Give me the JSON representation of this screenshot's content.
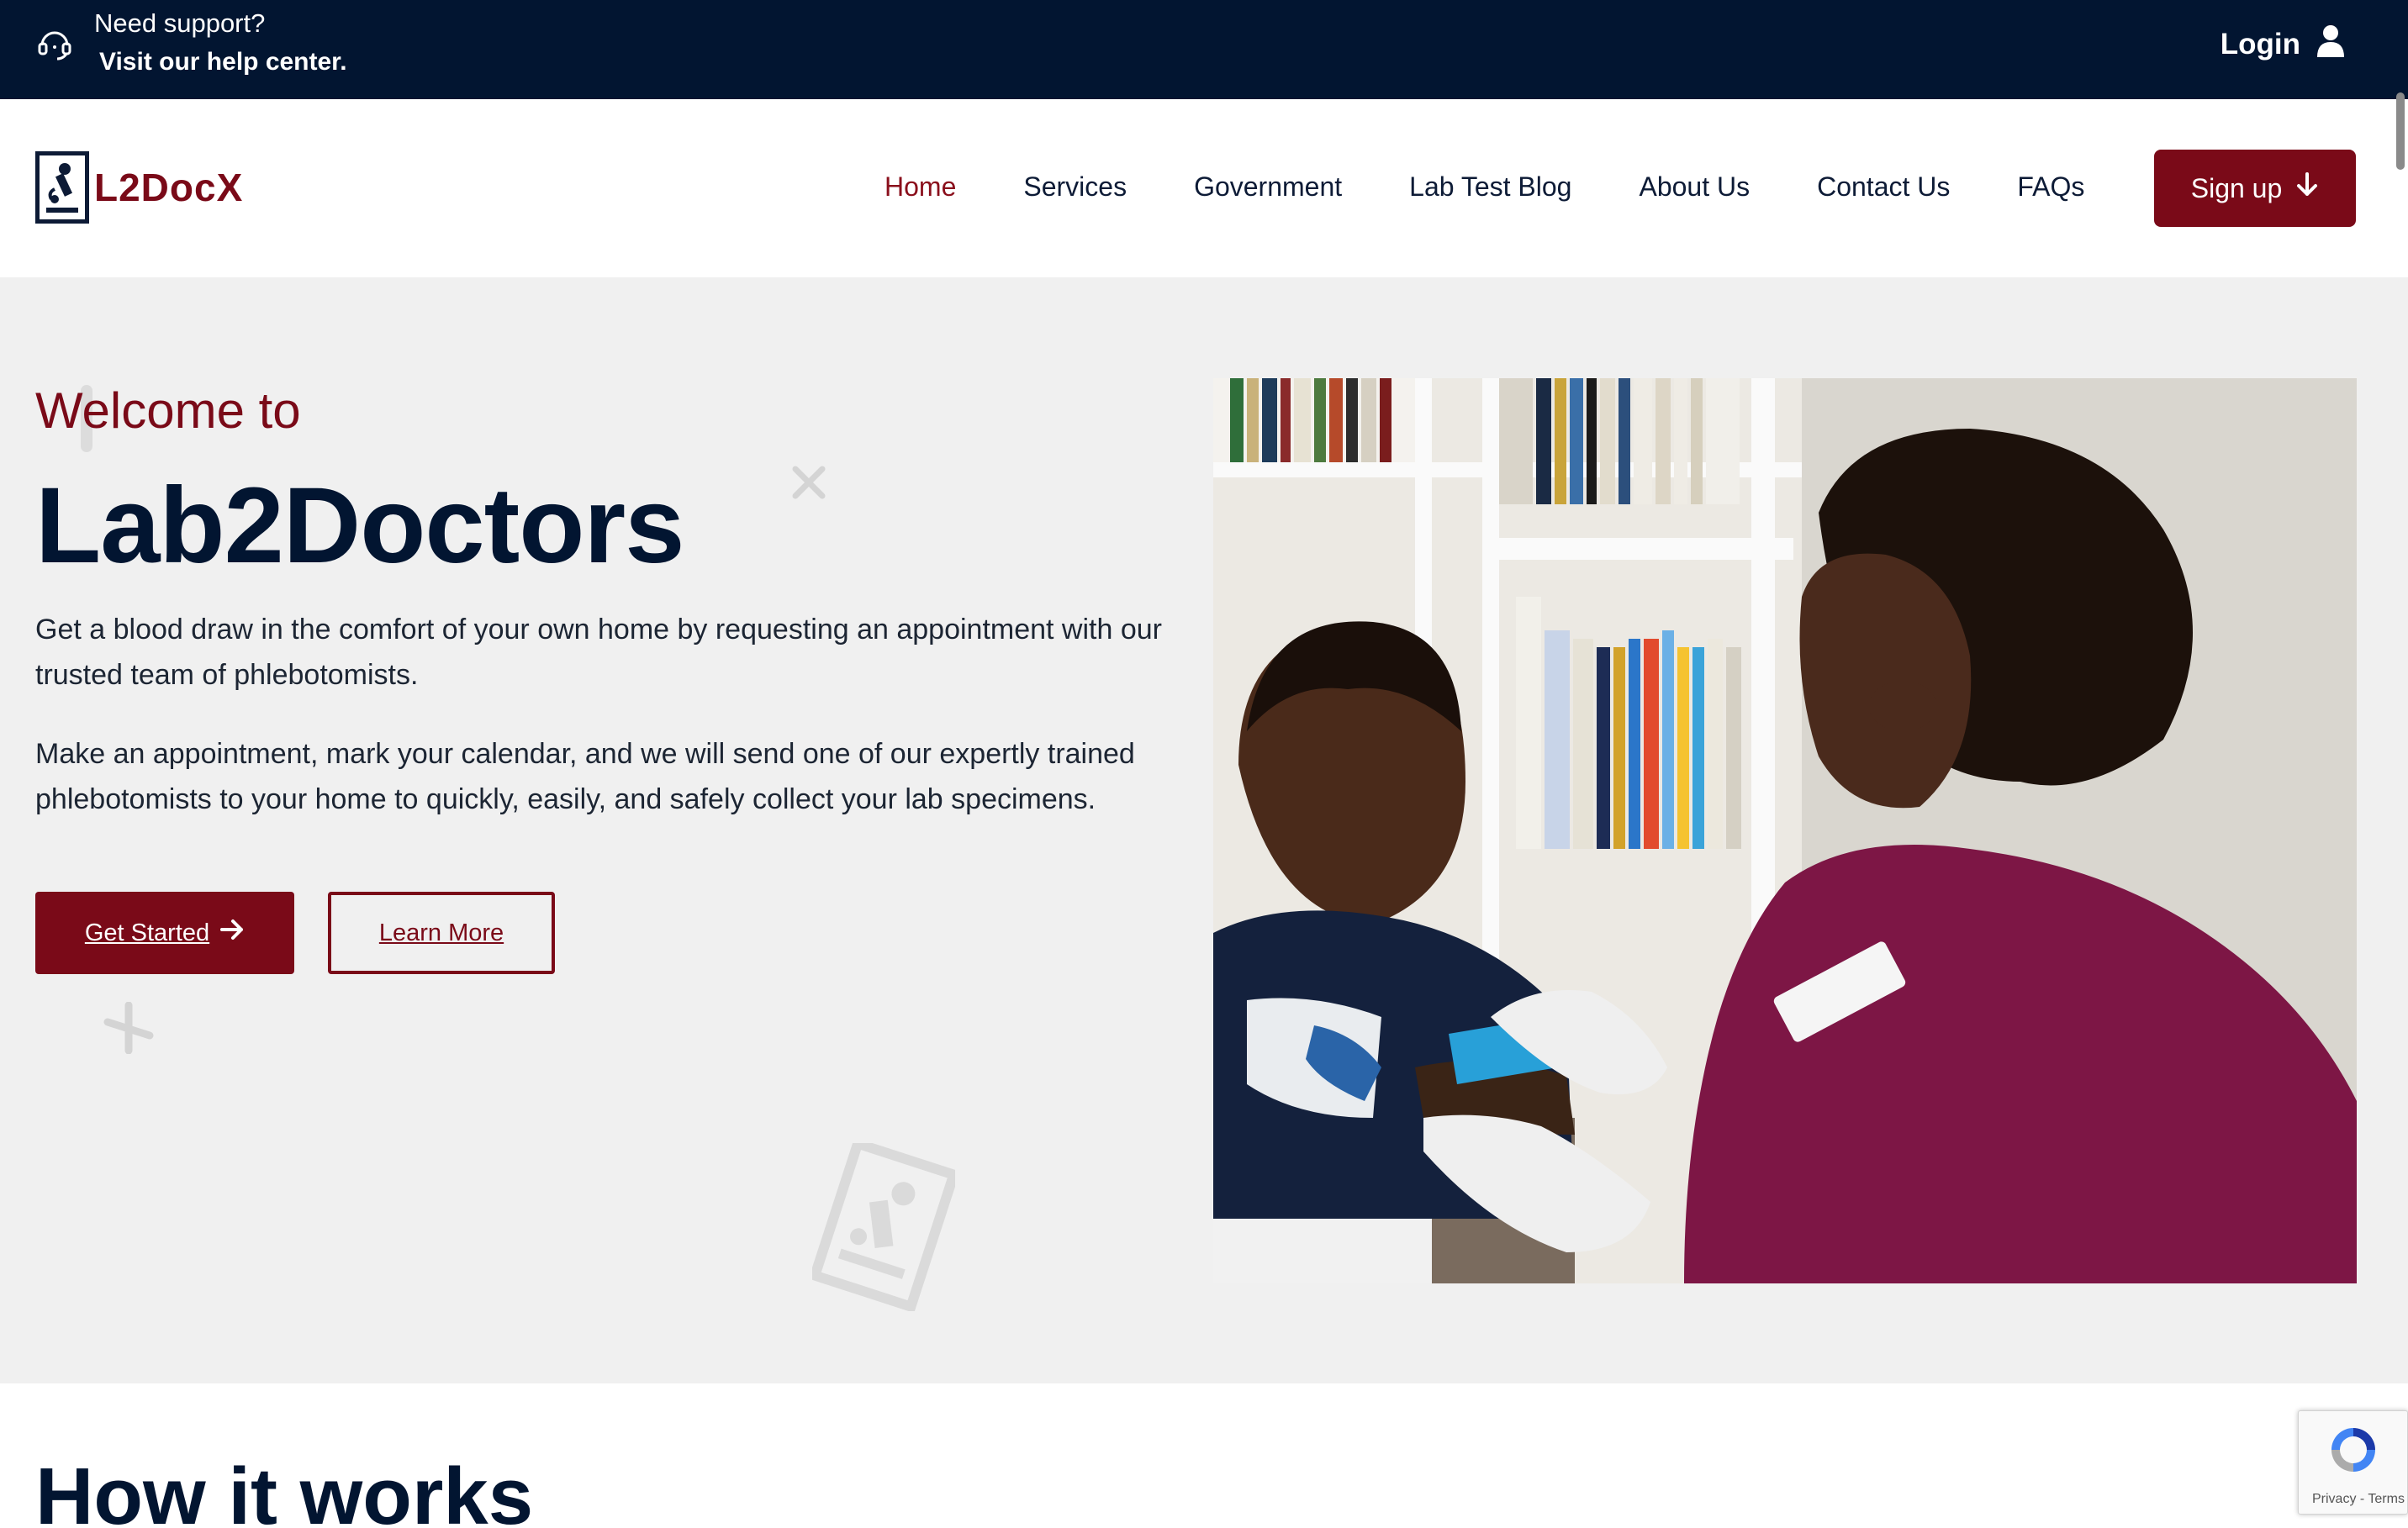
{
  "topbar": {
    "support_line1": "Need support?",
    "support_line2": "Visit our help center.",
    "login_label": "Login",
    "support_icon": "headset-icon",
    "login_icon": "user-icon"
  },
  "nav": {
    "logo_text": "L2DocX",
    "links": [
      "Home",
      "Services",
      "Government",
      "Lab Test Blog",
      "About Us",
      "Contact Us",
      "FAQs"
    ],
    "active": "Home",
    "signup_label": "Sign up",
    "signup_icon": "arrow-down-icon"
  },
  "hero": {
    "welcome": "Welcome to",
    "brand": "Lab2Doctors",
    "paragraph1": "Get a blood draw in the comfort of your own home by requesting an appointment with our trusted team of phlebotomists.",
    "paragraph2": "Make an appointment, mark your calendar, and we will send one of our expertly trained phlebotomists to your home to quickly, easily, and safely collect your lab specimens.",
    "primary_button": "Get Started",
    "secondary_button": "Learn More",
    "photo_alt": "photo"
  },
  "how": {
    "title": "How it works"
  },
  "recaptcha": {
    "label": "Privacy - Terms"
  },
  "colors": {
    "navy": "#021531",
    "maroon": "#7a0a18",
    "hero_bg": "#f0f0f0"
  }
}
